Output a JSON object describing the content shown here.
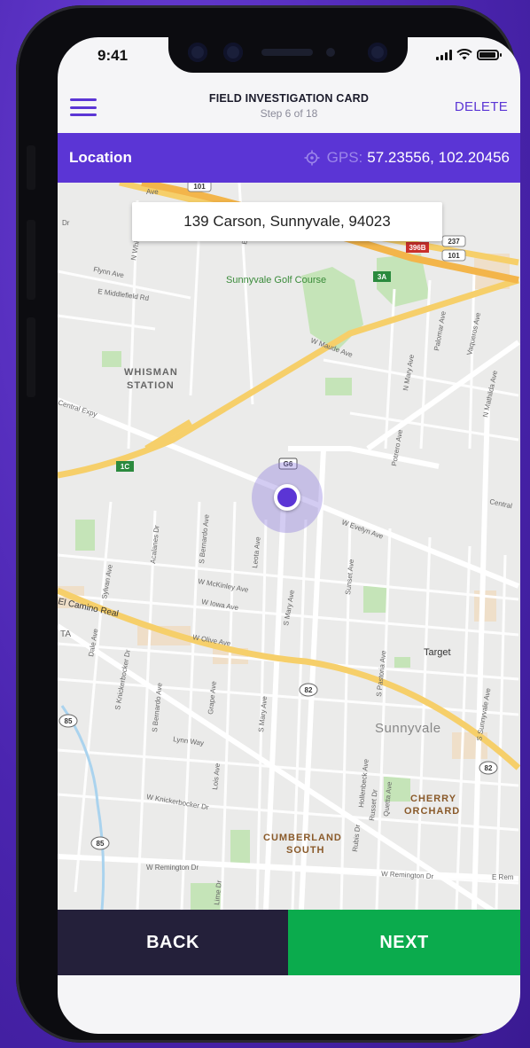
{
  "status_bar": {
    "time": "9:41"
  },
  "header": {
    "title": "FIELD INVESTIGATION CARD",
    "step": "Step 6 of 18",
    "delete_label": "DELETE"
  },
  "location_bar": {
    "label": "Location",
    "gps_prefix": "GPS:",
    "gps_coords": "57.23556, 102.20456"
  },
  "map": {
    "address": "139 Carson, Sunnyvale, 94023",
    "labels": {
      "golf": "Sunnyvale Golf Course",
      "whisman1": "WHISMAN",
      "whisman2": "STATION",
      "sunnyvale": "Sunnyvale",
      "target": "Target",
      "cherry1": "CHERRY",
      "cherry2": "ORCHARD",
      "cumberland1": "CUMBERLAND",
      "cumberland2": "SOUTH",
      "flynn": "Flynn Ave",
      "middlefield": "E Middlefield Rd",
      "maude": "W Maude Ave",
      "central_expy": "Central Expy",
      "central": "Central",
      "evelyn": "W Evelyn Ave",
      "el_camino": "El Camino Real",
      "mckinley": "W McKinley Ave",
      "iowa": "W Iowa Ave",
      "olive": "W Olive Ave",
      "lynn": "Lynn Way",
      "knickerbocker": "W Knickerbocker Dr",
      "remington": "W Remington Dr",
      "remington2": "W Remington Dr",
      "remington3": "E Rem",
      "mary": "S Mary Ave",
      "mary2": "S Mary Ave",
      "bernardo": "S Bernardo Ave",
      "bernardo2": "S Bernardo Ave",
      "pastoria": "S Pastoria Ave",
      "sunset": "Sunset Ave",
      "mathilda": "N Mathilda Ave",
      "potrero": "Potrero Ave",
      "ellis": "Ellis",
      "hollenbeck": "Hollenbeck Ave",
      "sunnyvale_ave": "S Sunnyvale Ave",
      "nmary": "N Mary Ave",
      "palomar": "Palomar Ave",
      "vaqueros": "Vaqueros Ave",
      "acalanes": "Acalanes Dr",
      "sylvan": "Sylvan Ave",
      "dale": "Dale Ave",
      "leota": "Leota Ave",
      "grape": "Grape Ave",
      "lois": "Lois Ave",
      "lime": "Lime Dr",
      "quetta": "Quetta Ave",
      "russet": "Russet Dr",
      "rubis": "Rubis Dr",
      "knick2": "S Knickerbocker Dr",
      "whisman_rd": "N Whisman",
      "dr": "Dr",
      "ta": "TA",
      "ave": "Ave"
    },
    "shields": {
      "s101a": "101",
      "s101b": "101",
      "s237": "237",
      "s396b": "396B",
      "s3a": "3A",
      "s1c": "1C",
      "sg6": "G6",
      "s82a": "82",
      "s82b": "82",
      "s85a": "85",
      "s85b": "85"
    }
  },
  "footer": {
    "back_label": "BACK",
    "next_label": "NEXT"
  },
  "colors": {
    "accent": "#5b35d5",
    "next": "#0bab4d",
    "back": "#24203a"
  }
}
